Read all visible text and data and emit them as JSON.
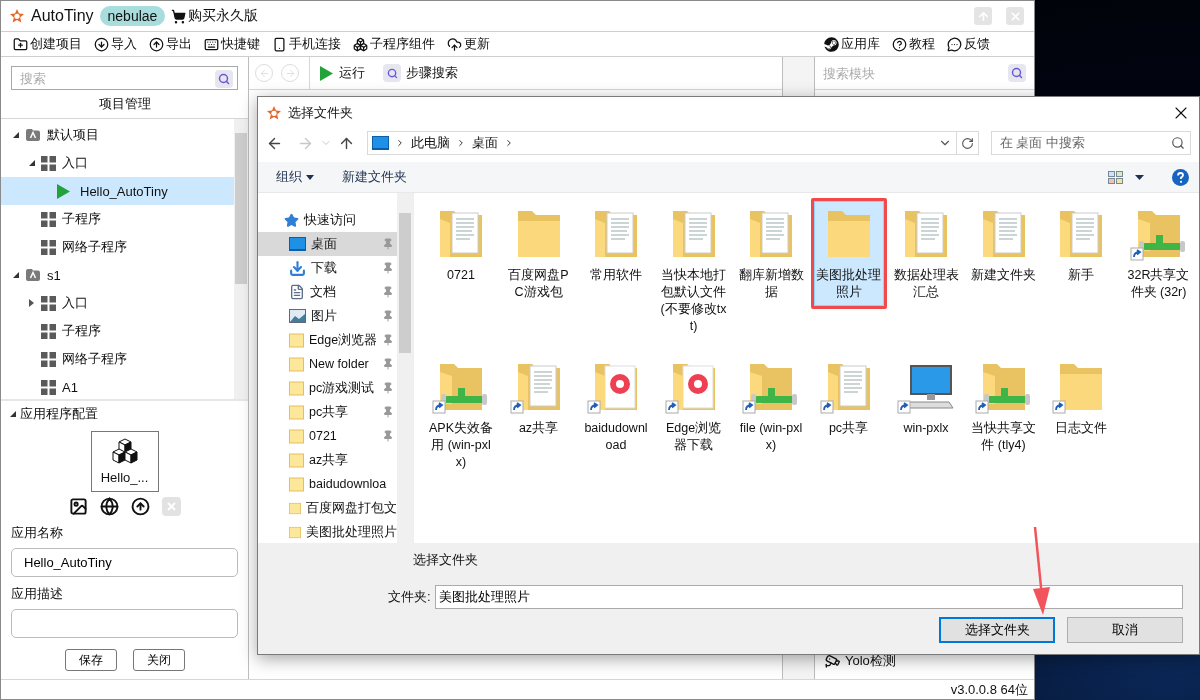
{
  "app": {
    "title": "AutoTiny",
    "edition": "nebulae",
    "buy": "购买永久版",
    "toolbar": [
      {
        "kind": "new",
        "label": "创建项目"
      },
      {
        "kind": "import",
        "label": "导入"
      },
      {
        "kind": "export",
        "label": "导出"
      },
      {
        "kind": "keys",
        "label": "快捷键"
      },
      {
        "kind": "phone",
        "label": "手机连接"
      },
      {
        "kind": "components",
        "label": "子程序组件"
      },
      {
        "kind": "update",
        "label": "更新"
      }
    ],
    "toolbar_right": [
      {
        "kind": "store",
        "label": "应用库"
      },
      {
        "kind": "help",
        "label": "教程"
      },
      {
        "kind": "feedback",
        "label": "反馈"
      }
    ]
  },
  "project": {
    "search_placeholder": "搜索",
    "title": "项目管理",
    "tree": [
      {
        "kind": "project",
        "label": "默认项目",
        "expanded": true,
        "selected": false,
        "children": [
          {
            "kind": "module",
            "label": "入口",
            "expanded": true,
            "selected": false,
            "children": [
              {
                "kind": "script",
                "label": "Hello_AutoTiny",
                "selected": true
              }
            ]
          },
          {
            "kind": "module",
            "label": "子程序",
            "selected": false
          },
          {
            "kind": "module",
            "label": "网络子程序",
            "selected": false
          }
        ]
      },
      {
        "kind": "project",
        "label": "s1",
        "expanded": true,
        "selected": false,
        "children": [
          {
            "kind": "module",
            "label": "入口",
            "expanded": false,
            "selected": false
          },
          {
            "kind": "module",
            "label": "子程序",
            "selected": false
          },
          {
            "kind": "module",
            "label": "网络子程序",
            "selected": false
          },
          {
            "kind": "module",
            "label": "A1",
            "selected": false
          }
        ]
      }
    ]
  },
  "config": {
    "title": "应用程序配置",
    "expanded": true,
    "app_icon_label": "Hello_...",
    "actions": [
      {
        "kind": "image",
        "disabled": false
      },
      {
        "kind": "globe",
        "disabled": false
      },
      {
        "kind": "upload",
        "disabled": false
      },
      {
        "kind": "delete",
        "disabled": true
      }
    ],
    "name_label": "应用名称",
    "name_value": "Hello_AutoTiny",
    "desc_label": "应用描述",
    "buttons": [
      "保存",
      "关闭"
    ]
  },
  "editor": {
    "run": "运行",
    "step_search": "步骤搜索"
  },
  "modules": {
    "search_placeholder": "搜索模块",
    "items": [
      {
        "kind": "camera",
        "label": "Yolo检测"
      }
    ]
  },
  "status": {
    "version": "v3.0.0.8 64位"
  },
  "dialog": {
    "title": "选择文件夹",
    "path": [
      "此电脑",
      "桌面"
    ],
    "search_placeholder": "在 桌面 中搜索",
    "organize": "组织",
    "new_folder": "新建文件夹",
    "nav": [
      {
        "kind": "quick",
        "label": "快速访问",
        "selected": false,
        "pinned": false
      },
      {
        "kind": "desktop",
        "label": "桌面",
        "selected": true,
        "pinned": true
      },
      {
        "kind": "download",
        "label": "下载",
        "selected": false,
        "pinned": true
      },
      {
        "kind": "docs",
        "label": "文档",
        "selected": false,
        "pinned": true
      },
      {
        "kind": "pictures",
        "label": "图片",
        "selected": false,
        "pinned": true
      },
      {
        "kind": "folder",
        "label": "Edge浏览器",
        "selected": false,
        "pinned": true
      },
      {
        "kind": "folder",
        "label": "New folder",
        "selected": false,
        "pinned": true
      },
      {
        "kind": "folder",
        "label": "pc游戏测试",
        "selected": false,
        "pinned": true
      },
      {
        "kind": "folder",
        "label": "pc共享",
        "selected": false,
        "pinned": true
      },
      {
        "kind": "folder",
        "label": "0721",
        "selected": false,
        "pinned": true
      },
      {
        "kind": "folder",
        "label": "az共享",
        "selected": false,
        "pinned": false
      },
      {
        "kind": "folder",
        "label": "baidudownloa",
        "selected": false,
        "pinned": false
      },
      {
        "kind": "folder",
        "label": "百度网盘打包文",
        "selected": false,
        "pinned": false
      },
      {
        "kind": "folder",
        "label": "美图批处理照片",
        "selected": false,
        "pinned": false
      }
    ],
    "files": [
      {
        "kind": "docs",
        "name": "0721",
        "shortcut": false,
        "selected": false
      },
      {
        "kind": "folder",
        "name": "百度网盘PC游戏包",
        "shortcut": false,
        "selected": false
      },
      {
        "kind": "docs",
        "name": "常用软件",
        "shortcut": false,
        "selected": false
      },
      {
        "kind": "docs",
        "name": "当快本地打包默认文件(不要修改txt)",
        "shortcut": false,
        "selected": false
      },
      {
        "kind": "docs",
        "name": "翻库新增数据",
        "shortcut": false,
        "selected": false
      },
      {
        "kind": "folder",
        "name": "美图批处理照片",
        "shortcut": false,
        "selected": true
      },
      {
        "kind": "docs",
        "name": "数据处理表汇总",
        "shortcut": false,
        "selected": false
      },
      {
        "kind": "docs",
        "name": "新建文件夹",
        "shortcut": false,
        "selected": false
      },
      {
        "kind": "docs",
        "name": "新手",
        "shortcut": false,
        "selected": false
      },
      {
        "kind": "network",
        "name": "32R共享文件夹 (32r)",
        "shortcut": true,
        "selected": false
      },
      {
        "kind": "network",
        "name": "APK失效备用 (win-pxlx)",
        "shortcut": true,
        "selected": false
      },
      {
        "kind": "docs",
        "name": "az共享",
        "shortcut": true,
        "selected": false
      },
      {
        "kind": "app",
        "name": "baidudownload",
        "shortcut": true,
        "selected": false
      },
      {
        "kind": "app",
        "name": "Edge浏览器下载",
        "shortcut": true,
        "selected": false
      },
      {
        "kind": "network",
        "name": "file (win-pxlx)",
        "shortcut": true,
        "selected": false
      },
      {
        "kind": "docs",
        "name": "pc共享",
        "shortcut": true,
        "selected": false
      },
      {
        "kind": "computer",
        "name": "win-pxlx",
        "shortcut": true,
        "selected": false
      },
      {
        "kind": "network",
        "name": "当快共享文件 (tly4)",
        "shortcut": true,
        "selected": false
      },
      {
        "kind": "folder",
        "name": "日志文件",
        "shortcut": true,
        "selected": false
      }
    ],
    "footer_title": "选择文件夹",
    "folder_label": "文件夹:",
    "folder_value": "美图批处理照片",
    "buttons": [
      {
        "label": "选择文件夹",
        "default": true
      },
      {
        "label": "取消",
        "default": false
      }
    ]
  }
}
